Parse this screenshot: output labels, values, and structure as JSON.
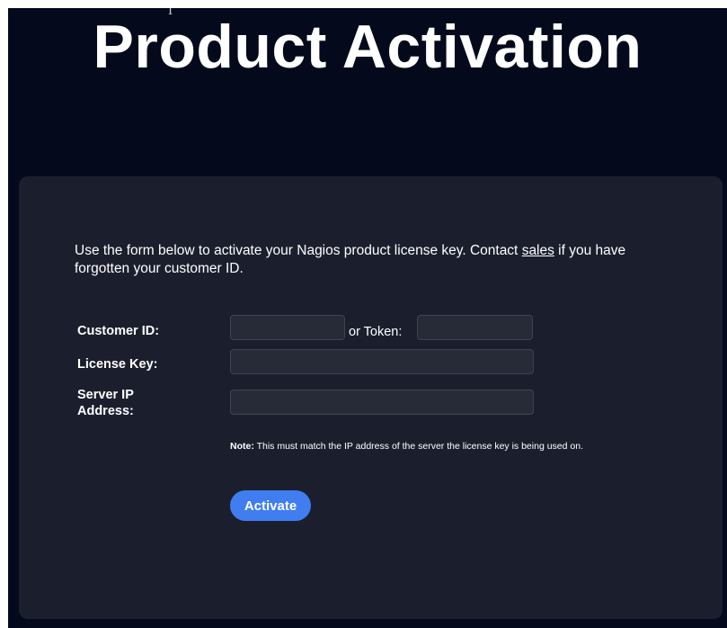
{
  "page": {
    "title": "Product Activation",
    "cursor_glyph": "I"
  },
  "form": {
    "intro_before": "Use the form below to activate your Nagios product license key. Contact ",
    "intro_link": "sales",
    "intro_after": " if you have forgotten your customer ID.",
    "customer_id_label": "Customer ID:",
    "customer_id_value": "",
    "or_token_label": "or Token:",
    "token_value": "",
    "license_key_label": "License Key:",
    "license_key_value": "",
    "server_ip_label": "Server IP Address:",
    "server_ip_value": "",
    "note_label": "Note:",
    "note_text": " This must match the IP address of the server the license key is being used on.",
    "activate_label": "Activate"
  },
  "colors": {
    "page_background": "#040a1c",
    "card_background": "#1b1f2d",
    "input_background": "#272b38",
    "accent_button": "#3f7df0",
    "text": "#ffffff"
  }
}
